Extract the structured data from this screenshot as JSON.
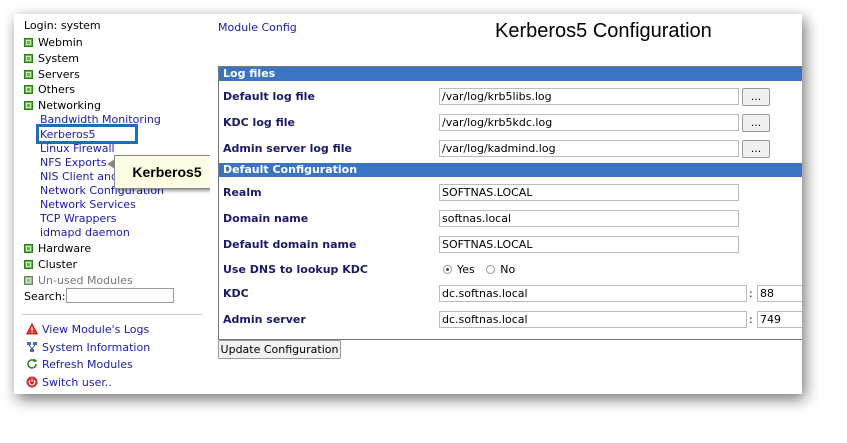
{
  "sidebar": {
    "login": "Login: system",
    "categories": [
      {
        "label": "Webmin"
      },
      {
        "label": "System"
      },
      {
        "label": "Servers"
      },
      {
        "label": "Others"
      },
      {
        "label": "Networking"
      }
    ],
    "networking_items": [
      {
        "label": "Bandwidth Monitoring"
      },
      {
        "label": "Kerberos5"
      },
      {
        "label": "Linux Firewall"
      },
      {
        "label": "NFS Exports"
      },
      {
        "label": "NIS Client and Server"
      },
      {
        "label": "Network Configuration"
      },
      {
        "label": "Network Services"
      },
      {
        "label": "TCP Wrappers"
      },
      {
        "label": "idmapd daemon"
      }
    ],
    "more_categories": [
      {
        "label": "Hardware"
      },
      {
        "label": "Cluster"
      },
      {
        "label": "Un-used Modules"
      }
    ],
    "search_label": "Search:",
    "search_value": "",
    "utilities": [
      {
        "label": "View Module's Logs",
        "icon": "warning-icon"
      },
      {
        "label": "System Information",
        "icon": "network-info-icon"
      },
      {
        "label": "Refresh Modules",
        "icon": "refresh-icon"
      },
      {
        "label": "Switch user..",
        "icon": "power-icon"
      }
    ]
  },
  "callout": {
    "label": "Kerberos5"
  },
  "header": {
    "module_config": "Module Config",
    "title": "Kerberos5 Configuration"
  },
  "sections": {
    "log_files": "Log files",
    "default_config": "Default Configuration"
  },
  "fields": {
    "default_log": {
      "label": "Default log file",
      "value": "/var/log/krb5libs.log"
    },
    "kdc_log": {
      "label": "KDC log file",
      "value": "/var/log/krb5kdc.log"
    },
    "admin_log": {
      "label": "Admin server log file",
      "value": "/var/log/kadmind.log"
    },
    "realm": {
      "label": "Realm",
      "value": "SOFTNAS.LOCAL"
    },
    "domain": {
      "label": "Domain name",
      "value": "softnas.local"
    },
    "default_domain": {
      "label": "Default domain name",
      "value": "SOFTNAS.LOCAL"
    },
    "use_dns": {
      "label": "Use DNS to lookup KDC",
      "yes": "Yes",
      "no": "No",
      "selected": "Yes"
    },
    "kdc": {
      "label": "KDC",
      "value": "dc.softnas.local",
      "port": "88"
    },
    "admin_server": {
      "label": "Admin server",
      "value": "dc.softnas.local",
      "port": "749"
    }
  },
  "buttons": {
    "browse": "...",
    "colon": ":",
    "update": "Update Configuration"
  },
  "colors": {
    "section_bar": "#3a74c3",
    "link": "#1a1ab0",
    "highlight_border": "#1f6fb5"
  }
}
